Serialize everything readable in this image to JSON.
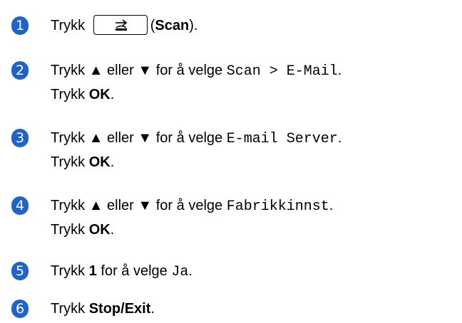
{
  "steps": [
    {
      "number": "1",
      "parts": {
        "a": "Trykk ",
        "b": "(",
        "c": "Scan",
        "d": ")."
      }
    },
    {
      "number": "2",
      "line1": {
        "a": "Trykk ▲ eller ▼ for å velge ",
        "mono": "Scan > E-Mail",
        "end": "."
      },
      "line2": {
        "a": "Trykk ",
        "bold": "OK",
        "end": "."
      }
    },
    {
      "number": "3",
      "line1": {
        "a": "Trykk ▲ eller ▼ for å velge ",
        "mono": "E-mail Server",
        "end": "."
      },
      "line2": {
        "a": "Trykk ",
        "bold": "OK",
        "end": "."
      }
    },
    {
      "number": "4",
      "line1": {
        "a": "Trykk ▲ eller ▼ for å velge ",
        "mono": "Fabrikkinnst",
        "end": "."
      },
      "line2": {
        "a": "Trykk ",
        "bold": "OK",
        "end": "."
      }
    },
    {
      "number": "5",
      "line1": {
        "a": "Trykk ",
        "bold": "1",
        "b": " for å velge ",
        "mono": "Ja",
        "end": "."
      }
    },
    {
      "number": "6",
      "line1": {
        "a": "Trykk ",
        "bold": "Stop/Exit",
        "end": "."
      }
    }
  ],
  "colors": {
    "badge": "#1e63c9"
  },
  "icons": {
    "scan_key": "scan-icon"
  }
}
